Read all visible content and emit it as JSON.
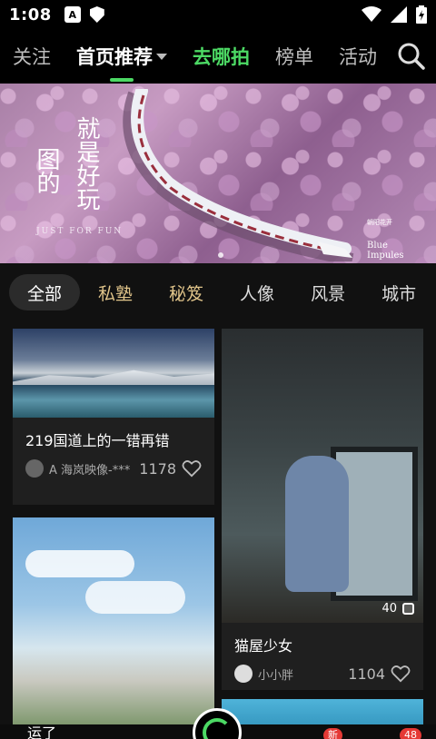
{
  "status": {
    "time": "1:08",
    "left_icons": [
      "a-badge-icon",
      "shield-icon"
    ],
    "right_icons": [
      "wifi-icon",
      "signal-icon",
      "battery-icon"
    ],
    "a_badge_text": "A"
  },
  "topnav": {
    "tabs": [
      {
        "label": "关注"
      },
      {
        "label": "首页推荐"
      },
      {
        "label": "去哪拍"
      },
      {
        "label": "榜单"
      },
      {
        "label": "活动"
      }
    ],
    "accent": "#4cd964"
  },
  "banner": {
    "title_col1": "图的",
    "title_col2": "就是好玩",
    "subtitle": "JUST FOR FUN",
    "right_text": "Blue Impules",
    "right_small": "朝阳花开"
  },
  "chips": [
    "全部",
    "私塾",
    "秘笈",
    "人像",
    "风景",
    "城市"
  ],
  "feed": {
    "cards": [
      {
        "title": "219国道上的一错再错",
        "author": "A 海岚映像-***",
        "likes": "1178"
      },
      {
        "title": "猫屋少女",
        "author": "小小胖",
        "likes": "1104",
        "photo_count": "40"
      }
    ]
  },
  "bottomnav": {
    "first_label": "运了",
    "badges": [
      "新",
      "48"
    ]
  }
}
